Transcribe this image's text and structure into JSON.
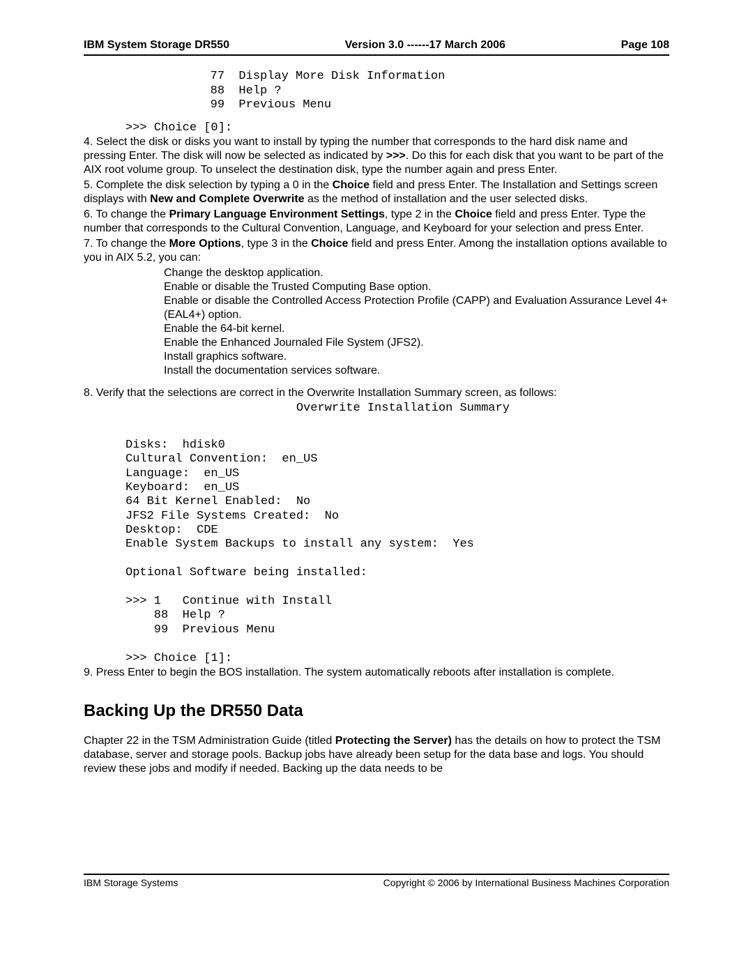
{
  "header": {
    "left": "IBM System Storage DR550",
    "center": "Version 3.0 ------17 March 2006",
    "right": "Page 108"
  },
  "menu1": {
    "line1": "        77  Display More Disk Information",
    "line2": "        88  Help ?",
    "line3": "        99  Previous Menu",
    "choice": ">>> Choice [0]:"
  },
  "steps": {
    "s4a": "4.  Select the disk or disks you want to install by typing the number that corresponds to the hard disk name and pressing Enter. The disk will now be selected as indicated by ",
    "s4b": ">>>",
    "s4c": ". Do this for each disk that you want to be part of the AIX root volume group. To unselect the destination disk, type the number again and press Enter.",
    "s5a": "5.  Complete the disk selection by typing a 0 in the ",
    "s5b": "Choice",
    "s5c": " field and press Enter. The Installation and Settings screen displays with ",
    "s5d": "New and Complete Overwrite",
    "s5e": " as the method of installation and the user selected disks.",
    "s6a": "6.  To change the ",
    "s6b": "Primary Language Environment Settings",
    "s6c": ", type 2 in the ",
    "s6d": "Choice",
    "s6e": " field and press Enter. Type the number that corresponds to the Cultural Convention, Language, and Keyboard for your selection and press Enter.",
    "s7a": "7.  To change the ",
    "s7b": "More Options",
    "s7c": ", type 3 in the ",
    "s7d": "Choice",
    "s7e": " field and press Enter. Among the installation options available to you in AIX 5.2, you can:",
    "opts": [
      "Change the desktop application.",
      "Enable or disable the Trusted Computing Base option.",
      "Enable or disable the Controlled Access Protection Profile (CAPP) and Evaluation Assurance Level 4+ (EAL4+) option.",
      "Enable the 64-bit kernel.",
      "Enable the Enhanced Journaled File System (JFS2).",
      "Install graphics software.",
      "Install the documentation services software."
    ],
    "s8": "8.  Verify that the selections are correct in the Overwrite Installation Summary screen, as follows:",
    "s9": "9.  Press Enter to begin the BOS installation. The system automatically reboots after installation is complete."
  },
  "summary": {
    "title": "                        Overwrite Installation Summary",
    "body1": "Disks:  hdisk0",
    "body2": "Cultural Convention:  en_US",
    "body3": "Language:  en_US",
    "body4": "Keyboard:  en_US",
    "body5": "64 Bit Kernel Enabled:  No",
    "body6": "JFS2 File Systems Created:  No",
    "body7": "Desktop:  CDE",
    "body8": "Enable System Backups to install any system:  Yes",
    "body9": "Optional Software being installed:",
    "menu1": ">>> 1   Continue with Install",
    "menu2": "    88  Help ?",
    "menu3": "    99  Previous Menu",
    "choice": ">>> Choice [1]:"
  },
  "section": {
    "title": "Backing Up the DR550 Data",
    "p1a": "Chapter 22 in the TSM Administration Guide (titled ",
    "p1b": "Protecting the Server)",
    "p1c": " has the details on how to protect the TSM database, server and storage pools.  Backup jobs have already been setup for the data base and logs.  You should review these jobs and modify if needed.  Backing up the data needs to be"
  },
  "footer": {
    "left": "IBM Storage Systems",
    "right": "Copyright © 2006 by International Business Machines Corporation"
  }
}
